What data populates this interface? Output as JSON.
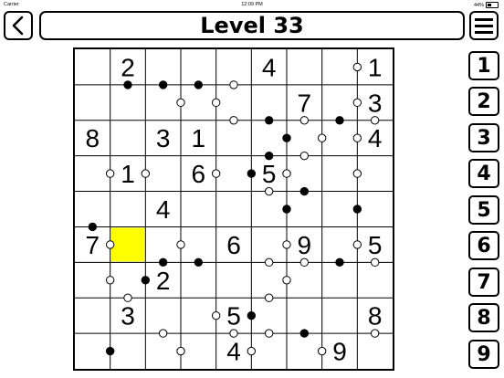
{
  "status": {
    "carrier": "Carrier",
    "time": "12:09 PM",
    "battery": "44%"
  },
  "title": "Level 33",
  "icons": {
    "back": "chevron-left-icon",
    "menu": "hamburger-menu-icon"
  },
  "colors": {
    "selected": "#ffff00",
    "grid": "#000000",
    "background": "#ffffff"
  },
  "puzzle": {
    "size": 9,
    "selected": [
      5,
      1
    ],
    "cells": [
      [
        "",
        "2",
        "",
        "",
        "",
        "4",
        "",
        "",
        "1"
      ],
      [
        "",
        "",
        "",
        "",
        "",
        "",
        "7",
        "",
        "3"
      ],
      [
        "8",
        "",
        "3",
        "1",
        "",
        "",
        "",
        "",
        "4"
      ],
      [
        "",
        "1",
        "",
        "6",
        "",
        "5",
        "",
        "",
        ""
      ],
      [
        "",
        "",
        "4",
        "",
        "",
        "",
        "",
        "",
        ""
      ],
      [
        "7",
        "",
        "",
        "",
        "6",
        "",
        "9",
        "",
        "5"
      ],
      [
        "",
        "",
        "2",
        "",
        "",
        "",
        "",
        "",
        ""
      ],
      [
        "",
        "3",
        "",
        "",
        "5",
        "",
        "",
        "",
        "8"
      ],
      [
        "",
        "",
        "",
        "",
        "4",
        "",
        "",
        "9",
        ""
      ]
    ],
    "dots": [
      {
        "a": [
          0,
          1
        ],
        "b": [
          1,
          1
        ],
        "black": true
      },
      {
        "a": [
          0,
          2
        ],
        "b": [
          1,
          2
        ],
        "black": true
      },
      {
        "a": [
          0,
          3
        ],
        "b": [
          1,
          3
        ],
        "black": true
      },
      {
        "a": [
          0,
          4
        ],
        "b": [
          1,
          4
        ],
        "black": false
      },
      {
        "a": [
          0,
          7
        ],
        "b": [
          0,
          8
        ],
        "black": false
      },
      {
        "a": [
          1,
          2
        ],
        "b": [
          1,
          3
        ],
        "black": false
      },
      {
        "a": [
          1,
          3
        ],
        "b": [
          1,
          4
        ],
        "black": false
      },
      {
        "a": [
          1,
          7
        ],
        "b": [
          1,
          8
        ],
        "black": false
      },
      {
        "a": [
          1,
          4
        ],
        "b": [
          2,
          4
        ],
        "black": false
      },
      {
        "a": [
          1,
          5
        ],
        "b": [
          2,
          5
        ],
        "black": true
      },
      {
        "a": [
          1,
          6
        ],
        "b": [
          2,
          6
        ],
        "black": false
      },
      {
        "a": [
          1,
          7
        ],
        "b": [
          2,
          7
        ],
        "black": true
      },
      {
        "a": [
          1,
          8
        ],
        "b": [
          2,
          8
        ],
        "black": false
      },
      {
        "a": [
          2,
          5
        ],
        "b": [
          2,
          6
        ],
        "black": true
      },
      {
        "a": [
          2,
          6
        ],
        "b": [
          2,
          7
        ],
        "black": false
      },
      {
        "a": [
          2,
          7
        ],
        "b": [
          2,
          8
        ],
        "black": false
      },
      {
        "a": [
          2,
          5
        ],
        "b": [
          3,
          5
        ],
        "black": true
      },
      {
        "a": [
          2,
          6
        ],
        "b": [
          3,
          6
        ],
        "black": false
      },
      {
        "a": [
          3,
          0
        ],
        "b": [
          3,
          1
        ],
        "black": false
      },
      {
        "a": [
          3,
          1
        ],
        "b": [
          3,
          2
        ],
        "black": false
      },
      {
        "a": [
          3,
          3
        ],
        "b": [
          3,
          4
        ],
        "black": false
      },
      {
        "a": [
          3,
          4
        ],
        "b": [
          3,
          5
        ],
        "black": true
      },
      {
        "a": [
          3,
          5
        ],
        "b": [
          3,
          6
        ],
        "black": false
      },
      {
        "a": [
          3,
          7
        ],
        "b": [
          3,
          8
        ],
        "black": false
      },
      {
        "a": [
          3,
          5
        ],
        "b": [
          4,
          5
        ],
        "black": false
      },
      {
        "a": [
          3,
          6
        ],
        "b": [
          4,
          6
        ],
        "black": true
      },
      {
        "a": [
          4,
          5
        ],
        "b": [
          4,
          6
        ],
        "black": true
      },
      {
        "a": [
          4,
          7
        ],
        "b": [
          4,
          8
        ],
        "black": true
      },
      {
        "a": [
          4,
          0
        ],
        "b": [
          5,
          0
        ],
        "black": true
      },
      {
        "a": [
          5,
          0
        ],
        "b": [
          5,
          1
        ],
        "black": false
      },
      {
        "a": [
          5,
          2
        ],
        "b": [
          5,
          3
        ],
        "black": false
      },
      {
        "a": [
          5,
          5
        ],
        "b": [
          5,
          6
        ],
        "black": false
      },
      {
        "a": [
          5,
          7
        ],
        "b": [
          5,
          8
        ],
        "black": false
      },
      {
        "a": [
          5,
          2
        ],
        "b": [
          6,
          2
        ],
        "black": true
      },
      {
        "a": [
          5,
          3
        ],
        "b": [
          6,
          3
        ],
        "black": true
      },
      {
        "a": [
          5,
          5
        ],
        "b": [
          6,
          5
        ],
        "black": false
      },
      {
        "a": [
          5,
          6
        ],
        "b": [
          6,
          6
        ],
        "black": false
      },
      {
        "a": [
          5,
          7
        ],
        "b": [
          6,
          7
        ],
        "black": true
      },
      {
        "a": [
          5,
          8
        ],
        "b": [
          6,
          8
        ],
        "black": false
      },
      {
        "a": [
          6,
          0
        ],
        "b": [
          6,
          1
        ],
        "black": false
      },
      {
        "a": [
          6,
          1
        ],
        "b": [
          6,
          2
        ],
        "black": true
      },
      {
        "a": [
          6,
          5
        ],
        "b": [
          6,
          6
        ],
        "black": false
      },
      {
        "a": [
          6,
          1
        ],
        "b": [
          7,
          1
        ],
        "black": false
      },
      {
        "a": [
          6,
          5
        ],
        "b": [
          7,
          5
        ],
        "black": false
      },
      {
        "a": [
          7,
          3
        ],
        "b": [
          7,
          4
        ],
        "black": false
      },
      {
        "a": [
          7,
          4
        ],
        "b": [
          7,
          5
        ],
        "black": true
      },
      {
        "a": [
          7,
          2
        ],
        "b": [
          8,
          2
        ],
        "black": false
      },
      {
        "a": [
          7,
          4
        ],
        "b": [
          8,
          4
        ],
        "black": false
      },
      {
        "a": [
          7,
          5
        ],
        "b": [
          8,
          5
        ],
        "black": false
      },
      {
        "a": [
          7,
          6
        ],
        "b": [
          8,
          6
        ],
        "black": true
      },
      {
        "a": [
          7,
          8
        ],
        "b": [
          8,
          8
        ],
        "black": false
      },
      {
        "a": [
          8,
          0
        ],
        "b": [
          8,
          1
        ],
        "black": true
      },
      {
        "a": [
          8,
          2
        ],
        "b": [
          8,
          3
        ],
        "black": false
      },
      {
        "a": [
          8,
          4
        ],
        "b": [
          8,
          5
        ],
        "black": false
      },
      {
        "a": [
          8,
          6
        ],
        "b": [
          8,
          7
        ],
        "black": false
      }
    ]
  },
  "numpad": [
    "1",
    "2",
    "3",
    "4",
    "5",
    "6",
    "7",
    "8",
    "9"
  ]
}
